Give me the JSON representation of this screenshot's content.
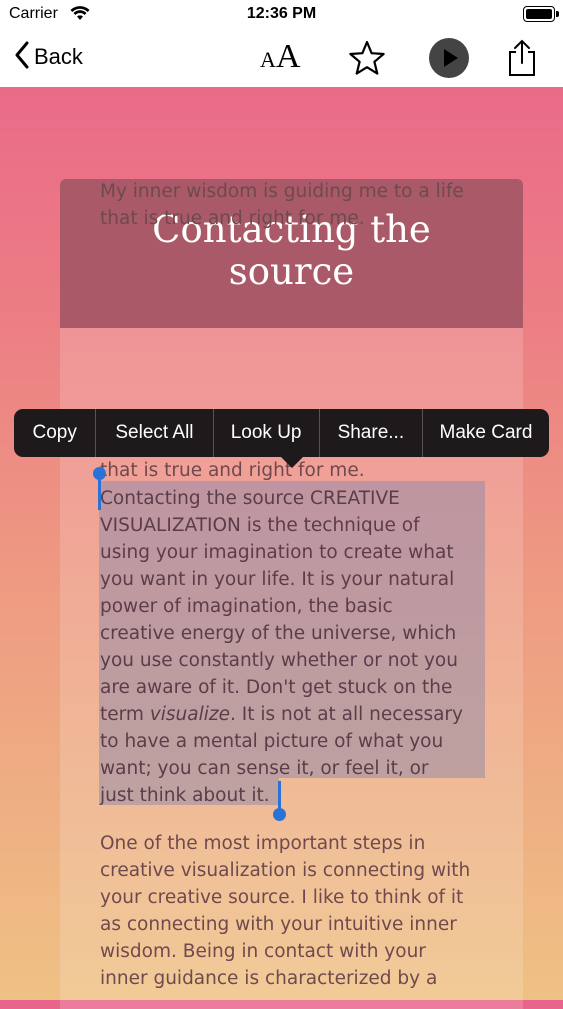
{
  "status_bar": {
    "carrier": "Carrier",
    "time": "12:36 PM"
  },
  "nav": {
    "back_label": "Back",
    "font_small": "A",
    "font_big": "A",
    "icons": [
      "chevron-left-icon",
      "font-size-icon",
      "star-icon",
      "play-icon",
      "share-icon"
    ]
  },
  "article": {
    "title_line1": "Contacting the",
    "title_line2": "source",
    "paragraph1": [
      "My inner wisdom is guiding me to a life",
      "that is true and right for me."
    ],
    "paragraph1_repeat": "that is true and right for me.",
    "selected_lines": [
      "Contacting the source CREATIVE",
      "VISUALIZATION is the technique of",
      "using your imagination to create what",
      "you want in your life. It is your natural",
      "power of imagination, the basic",
      "creative energy of the universe, which",
      "you use constantly whether or not you",
      "are aware of it. Don't get stuck on the",
      "term visualize. It is not at all necessary",
      "to have a mental picture of what you",
      "want; you can sense it, or feel it, or",
      "just think about it."
    ],
    "paragraph2": [
      "One of the most important steps in",
      "creative visualization is connecting with",
      "your creative source. I like to think of it",
      "as connecting with your intuitive inner",
      "wisdom. Being in contact with your",
      "inner guidance is characterized by a"
    ]
  },
  "edit_menu": {
    "items": [
      "Copy",
      "Select All",
      "Look Up",
      "Share...",
      "Make Card"
    ]
  },
  "colors": {
    "header_bg": "#a95967",
    "selection_handle": "#2a72d6",
    "menu_bg": "#1e1a1c"
  }
}
